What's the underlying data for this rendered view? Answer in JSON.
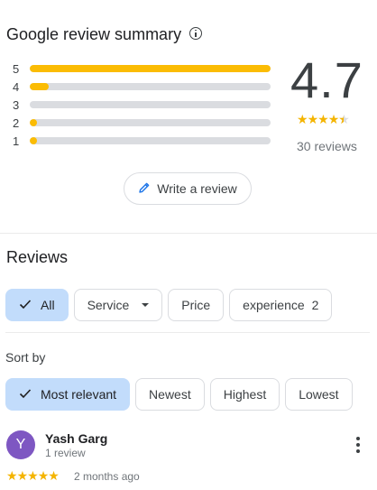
{
  "summary": {
    "title": "Google review summary",
    "rating": "4.7",
    "rating_value": 4.7,
    "review_count_text": "30 reviews",
    "write_review_label": "Write a review",
    "bars": [
      {
        "label": "5",
        "fraction": 1.0
      },
      {
        "label": "4",
        "fraction": 0.08
      },
      {
        "label": "3",
        "fraction": 0.0
      },
      {
        "label": "2",
        "fraction": 0.03
      },
      {
        "label": "1",
        "fraction": 0.03
      }
    ]
  },
  "reviews": {
    "title": "Reviews",
    "filters": [
      {
        "label": "All",
        "selected": true
      },
      {
        "label": "Service",
        "selected": false
      },
      {
        "label": "Price",
        "selected": false
      },
      {
        "label": "experience",
        "count": "2",
        "selected": false
      }
    ],
    "sort_label": "Sort by",
    "sort_options": [
      {
        "label": "Most relevant",
        "selected": true
      },
      {
        "label": "Newest",
        "selected": false
      },
      {
        "label": "Highest",
        "selected": false
      },
      {
        "label": "Lowest",
        "selected": false
      }
    ],
    "items": [
      {
        "avatar_letter": "Y",
        "avatar_color": "#7e57c2",
        "name": "Yash Garg",
        "meta": "1 review",
        "stars": 5,
        "date": "2 months ago"
      }
    ]
  },
  "colors": {
    "accent_star": "#fbbc04",
    "chip_selected": "#c2dcfb"
  },
  "icons": [
    "info-icon",
    "pencil-icon",
    "check-icon",
    "chevron-down-icon",
    "more-vert-icon",
    "star-icon"
  ]
}
